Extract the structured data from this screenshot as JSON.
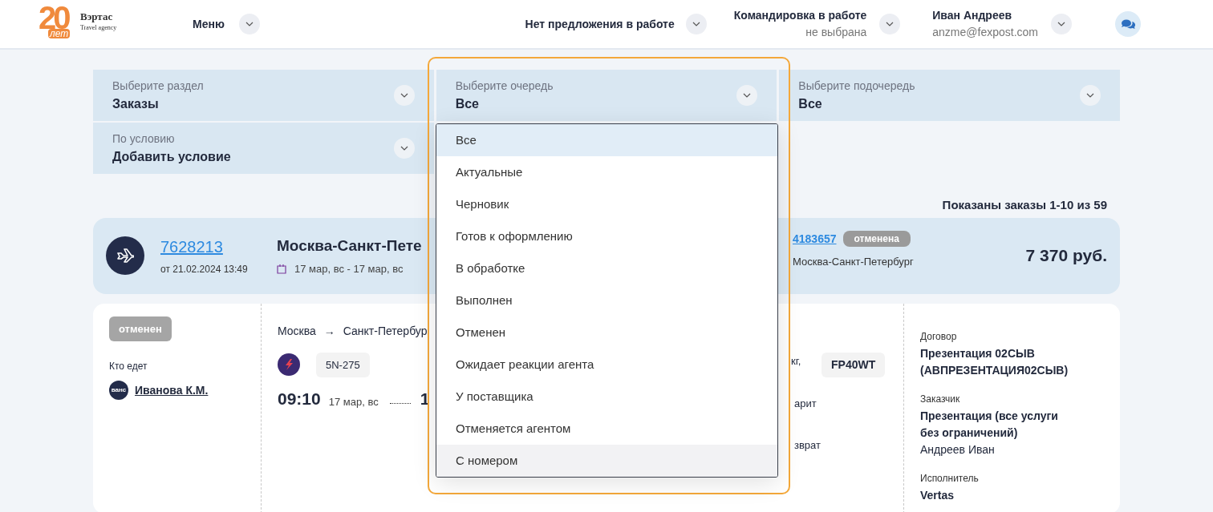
{
  "header": {
    "logo": {
      "number": "20",
      "years": "лет",
      "name": "Вэртас",
      "tagline": "Travel agency"
    },
    "menu": "Меню",
    "offer": "Нет предложения в работе",
    "trip": {
      "title": "Командировка в работе",
      "value": "не выбрана"
    },
    "user": {
      "name": "Иван Андреев",
      "email": "anzme@fexpost.com"
    }
  },
  "filters": [
    {
      "label": "Выберите раздел",
      "value": "Заказы"
    },
    {
      "label": "Выберите очередь",
      "value": "Все"
    },
    {
      "label": "Выберите подочередь",
      "value": "Все"
    },
    {
      "label": "По условию",
      "value": "Добавить условие"
    }
  ],
  "queue_options": [
    {
      "label": "Все",
      "selected": true,
      "hovered": false
    },
    {
      "label": "Актуальные",
      "selected": false,
      "hovered": false
    },
    {
      "label": "Черновик",
      "selected": false,
      "hovered": false
    },
    {
      "label": "Готов к оформлению",
      "selected": false,
      "hovered": false
    },
    {
      "label": "В обработке",
      "selected": false,
      "hovered": false
    },
    {
      "label": "Выполнен",
      "selected": false,
      "hovered": false
    },
    {
      "label": "Отменен",
      "selected": false,
      "hovered": false
    },
    {
      "label": "Ожидает реакции агента",
      "selected": false,
      "hovered": false
    },
    {
      "label": "У поставщика",
      "selected": false,
      "hovered": false
    },
    {
      "label": "Отменяется агентом",
      "selected": false,
      "hovered": false
    },
    {
      "label": "С номером",
      "selected": false,
      "hovered": true
    }
  ],
  "summary": "Показаны заказы 1-10 из 59",
  "order": {
    "number": "7628213",
    "date": "от 21.02.2024 13:49",
    "title": "Москва-Санкт-Пете",
    "dates": "17 мар, вс - 17 мар, вс",
    "service_number": "4183657",
    "service_status": "отменена",
    "service_route": "Москва-Санкт-Петербург",
    "price": "7 370 руб."
  },
  "details": {
    "status": "отменен",
    "travelers_label": "Кто едет",
    "traveler_avatar_text": "ванс",
    "traveler": "Иванова К.М.",
    "from": "Москва",
    "arrow": "→",
    "to": "Санкт-Петербур",
    "flight": "5N-275",
    "departure_time": "09:10",
    "departure_date": "17 мар, вс",
    "arrival_time": "1",
    "baggage": "кг,",
    "fare": "арит",
    "refund": "зврат",
    "pnr": "FP40WT",
    "info": [
      {
        "label": "Договор",
        "lines": [
          "Презентация 02СЫВ",
          "(АВПРЕЗЕНТАЦИЯ02СЫВ)"
        ]
      },
      {
        "label": "Заказчик",
        "lines": [
          "Презентация (все услуги",
          "без ограничений)"
        ],
        "note": "Андреев Иван"
      },
      {
        "label": "Исполнитель",
        "lines": [
          "Vertas"
        ]
      }
    ]
  }
}
